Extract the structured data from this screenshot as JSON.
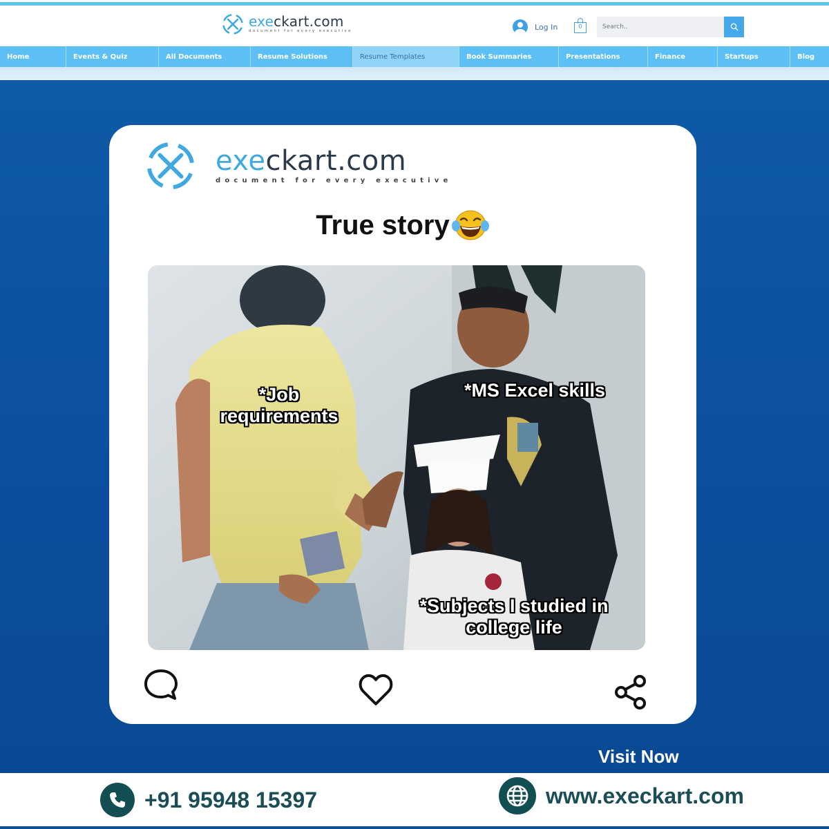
{
  "site": {
    "brand_prefix": "exe",
    "brand_suffix": "ckart.com",
    "tagline": "document for every executive",
    "login_label": "Log In",
    "cart_count": "0",
    "search_placeholder": "Search..",
    "nav": [
      "Home",
      "Events & Quiz",
      "All Documents",
      "Resume Solutions",
      "Resume Templates",
      "Book Summaries",
      "Presentations",
      "Finance",
      "Startups",
      "Blog"
    ],
    "active_nav": "Resume Templates"
  },
  "post": {
    "brand_prefix": "exe",
    "brand_suffix": "ckart.com",
    "tagline": "document for every executive",
    "title": "True story",
    "title_emoji": "face-with-tears-of-joy",
    "captions": {
      "job": "*Job requirements",
      "excel": "*MS Excel skills",
      "subjects": "*Subjects I studied in college life"
    },
    "actions": [
      "comment-icon",
      "heart-icon",
      "share-icon"
    ]
  },
  "visit_label": "Visit Now",
  "footer": {
    "phone": "+91 95948 15397",
    "website": "www.execkart.com"
  },
  "colors": {
    "nav_bg": "#5cc0f4",
    "stage_bg": "#0b4f9c",
    "brand_accent": "#3fa9e0",
    "footer_icon": "#124e52"
  }
}
